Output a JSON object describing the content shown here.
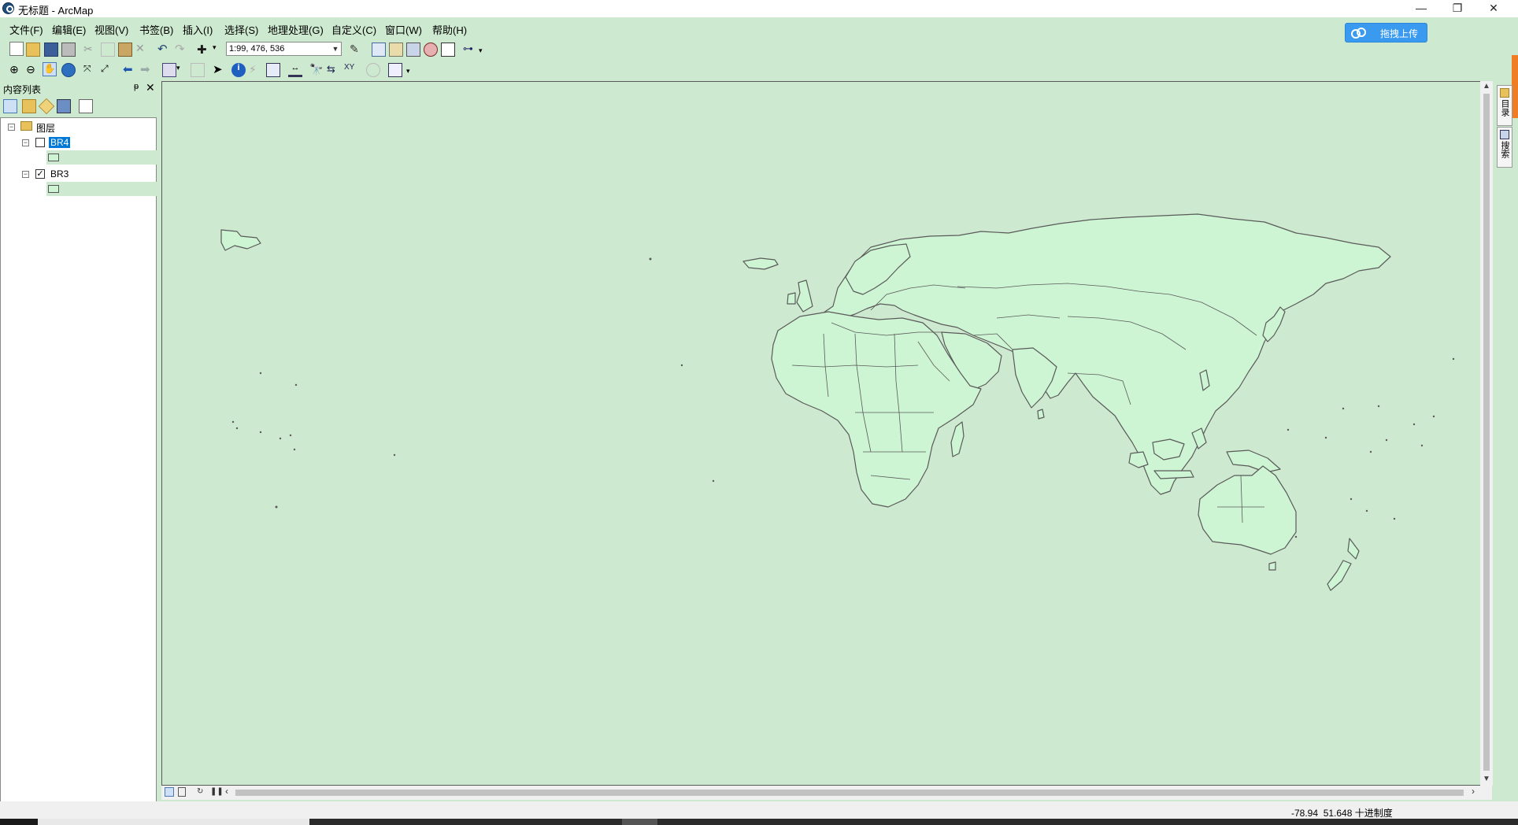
{
  "window": {
    "title": "无标题 - ArcMap",
    "controls": [
      "—",
      "❐",
      "✕"
    ]
  },
  "menu": [
    "文件(F)",
    "编辑(E)",
    "视图(V)",
    "书签(B)",
    "插入(I)",
    "选择(S)",
    "地理处理(G)",
    "自定义(C)",
    "窗口(W)",
    "帮助(H)"
  ],
  "upload_button": {
    "label": "拖拽上传"
  },
  "toolbar": {
    "scale_value": "1:99, 476, 536"
  },
  "toc": {
    "title": "内容列表",
    "pin": "ᵽ",
    "close": "✕",
    "root_label": "图层",
    "layers": [
      {
        "name": "BR4",
        "checked": false,
        "selected": true
      },
      {
        "name": "BR3",
        "checked": true,
        "selected": false
      }
    ]
  },
  "dock_tabs": [
    "目录",
    "搜索"
  ],
  "status": {
    "x": "-78.94",
    "y": "51.648",
    "units": "十进制度"
  },
  "colors": {
    "map_background": "#cde9cf",
    "land_fill": "#cdf5d3",
    "outline": "#5a5a5a",
    "selection": "#0078d7",
    "upload_blue": "#3a9aef"
  }
}
